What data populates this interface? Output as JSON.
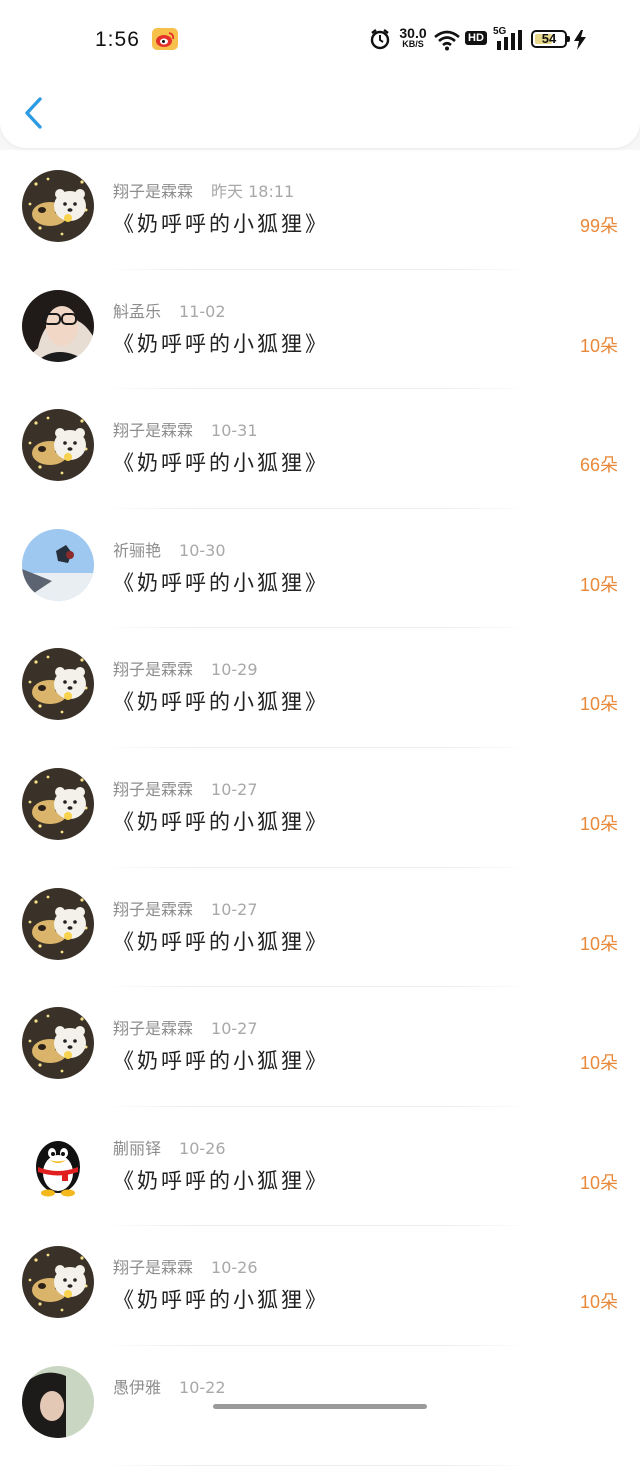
{
  "status_bar": {
    "time": "1:56",
    "net_speed_value": "30.0",
    "net_speed_unit": "KB/S",
    "hd_label": "HD",
    "network_label": "5G",
    "battery_level": "54"
  },
  "header": {
    "back_icon": "chevron-left-icon",
    "accent_color": "#2d9be3"
  },
  "list": {
    "items": [
      {
        "name": "翔子是霖霖",
        "date": "昨天 18:11",
        "title": "《奶呼呼的小狐狸》",
        "count": "99朵",
        "avatar": "bear"
      },
      {
        "name": "斛孟乐",
        "date": "11-02",
        "title": "《奶呼呼的小狐狸》",
        "count": "10朵",
        "avatar": "girl"
      },
      {
        "name": "翔子是霖霖",
        "date": "10-31",
        "title": "《奶呼呼的小狐狸》",
        "count": "66朵",
        "avatar": "bear"
      },
      {
        "name": "祈骊艳",
        "date": "10-30",
        "title": "《奶呼呼的小狐狸》",
        "count": "10朵",
        "avatar": "sky"
      },
      {
        "name": "翔子是霖霖",
        "date": "10-29",
        "title": "《奶呼呼的小狐狸》",
        "count": "10朵",
        "avatar": "bear"
      },
      {
        "name": "翔子是霖霖",
        "date": "10-27",
        "title": "《奶呼呼的小狐狸》",
        "count": "10朵",
        "avatar": "bear"
      },
      {
        "name": "翔子是霖霖",
        "date": "10-27",
        "title": "《奶呼呼的小狐狸》",
        "count": "10朵",
        "avatar": "bear"
      },
      {
        "name": "翔子是霖霖",
        "date": "10-27",
        "title": "《奶呼呼的小狐狸》",
        "count": "10朵",
        "avatar": "bear"
      },
      {
        "name": "蒯丽铎",
        "date": "10-26",
        "title": "《奶呼呼的小狐狸》",
        "count": "10朵",
        "avatar": "penguin"
      },
      {
        "name": "翔子是霖霖",
        "date": "10-26",
        "title": "《奶呼呼的小狐狸》",
        "count": "10朵",
        "avatar": "bear"
      },
      {
        "name": "愚伊雅",
        "date": "10-22",
        "title": "",
        "count": "",
        "avatar": "dark"
      }
    ]
  },
  "colors": {
    "count": "#e8883a",
    "meta": "#9a9a9a",
    "title": "#222222"
  }
}
